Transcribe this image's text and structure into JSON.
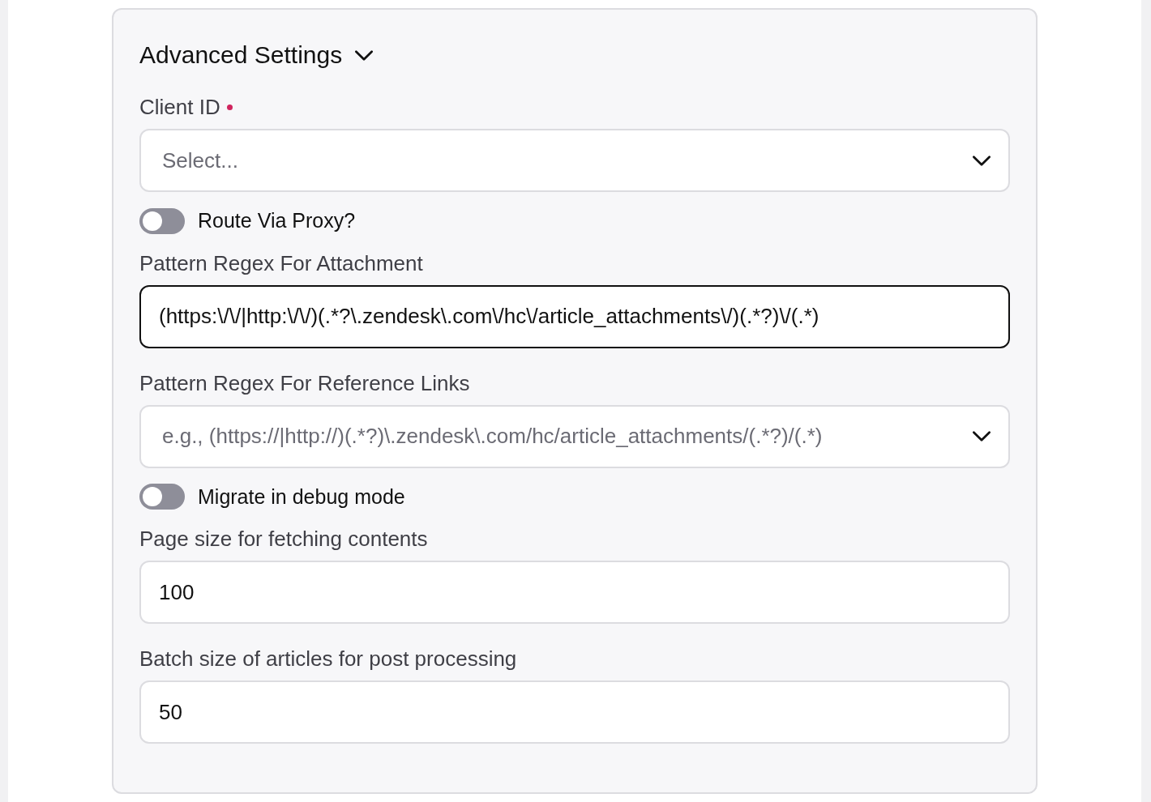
{
  "section": {
    "title": "Advanced Settings",
    "expanded": true
  },
  "fields": [
    {
      "kind": "select",
      "label": "Client ID",
      "required": true,
      "placeholder": "Select..."
    },
    {
      "kind": "toggle",
      "label": "Route Via Proxy?",
      "on": false
    },
    {
      "kind": "input",
      "label": "Pattern Regex For Attachment",
      "value": "(https:\\/\\/|http:\\/\\/)(.*?\\.zendesk\\.com\\/hc\\/article_attachments\\/)(.*?)\\/(.*)",
      "focused": true
    },
    {
      "kind": "select",
      "label": "Pattern Regex For Reference Links",
      "required": false,
      "placeholder": "e.g., (https://|http://)(.*?)\\.zendesk\\.com/hc/article_attachments/(.*?)/(.*)"
    },
    {
      "kind": "toggle",
      "label": "Migrate in debug mode",
      "on": false
    },
    {
      "kind": "input",
      "label": "Page size for fetching contents",
      "value": "100",
      "focused": false
    },
    {
      "kind": "input",
      "label": "Batch size of articles for post processing",
      "value": "50",
      "focused": false
    }
  ]
}
